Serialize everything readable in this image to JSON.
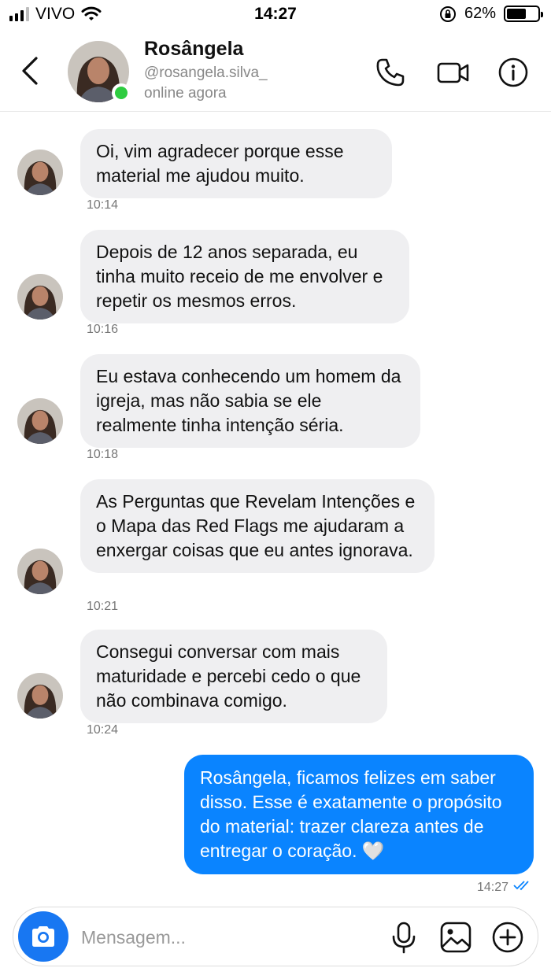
{
  "status_bar": {
    "carrier": "VIVO",
    "time": "14:27",
    "battery": "62%",
    "battery_level": 0.62
  },
  "header": {
    "name": "Rosângela",
    "username": "@rosangela.silva_",
    "status": "online agora",
    "icons": [
      "back-arrow-icon",
      "phone-icon",
      "video-camera-icon",
      "info-icon"
    ]
  },
  "messages": [
    {
      "from": "contact",
      "text": "Oi, vim agradecer porque esse material me ajudou muito.",
      "time": "10:14"
    },
    {
      "from": "contact",
      "text": "Depois de 12 anos separada, eu tinha muito receio de me envolver e repetir os mesmos erros.",
      "time": "10:16"
    },
    {
      "from": "contact",
      "text": "Eu estava conhecendo um homem da igreja, mas não sabia se ele realmente tinha intenção séria.",
      "time": "10:18"
    },
    {
      "from": "contact",
      "text": "As Perguntas que Revelam Intenções e o Mapa das Red Flags me ajudaram a enxergar coisas que eu antes ignorava.",
      "time": "10:21"
    },
    {
      "from": "contact",
      "text": "Consegui conversar com mais maturidade e percebi cedo o que não combinava comigo.",
      "time": "10:24"
    },
    {
      "from": "me",
      "text": "Rosângela, ficamos felizes em saber disso. Esse é exatamente o propósito do material: trazer clareza antes de entregar o coração. 🤍",
      "time": "14:27"
    }
  ],
  "composer": {
    "placeholder": "Mensagem...",
    "value": ""
  },
  "colors": {
    "outgoing_bubble": "#0a84ff",
    "incoming_bubble": "#efeff1",
    "online": "#2ecc40",
    "camera_button": "#1877f2"
  }
}
